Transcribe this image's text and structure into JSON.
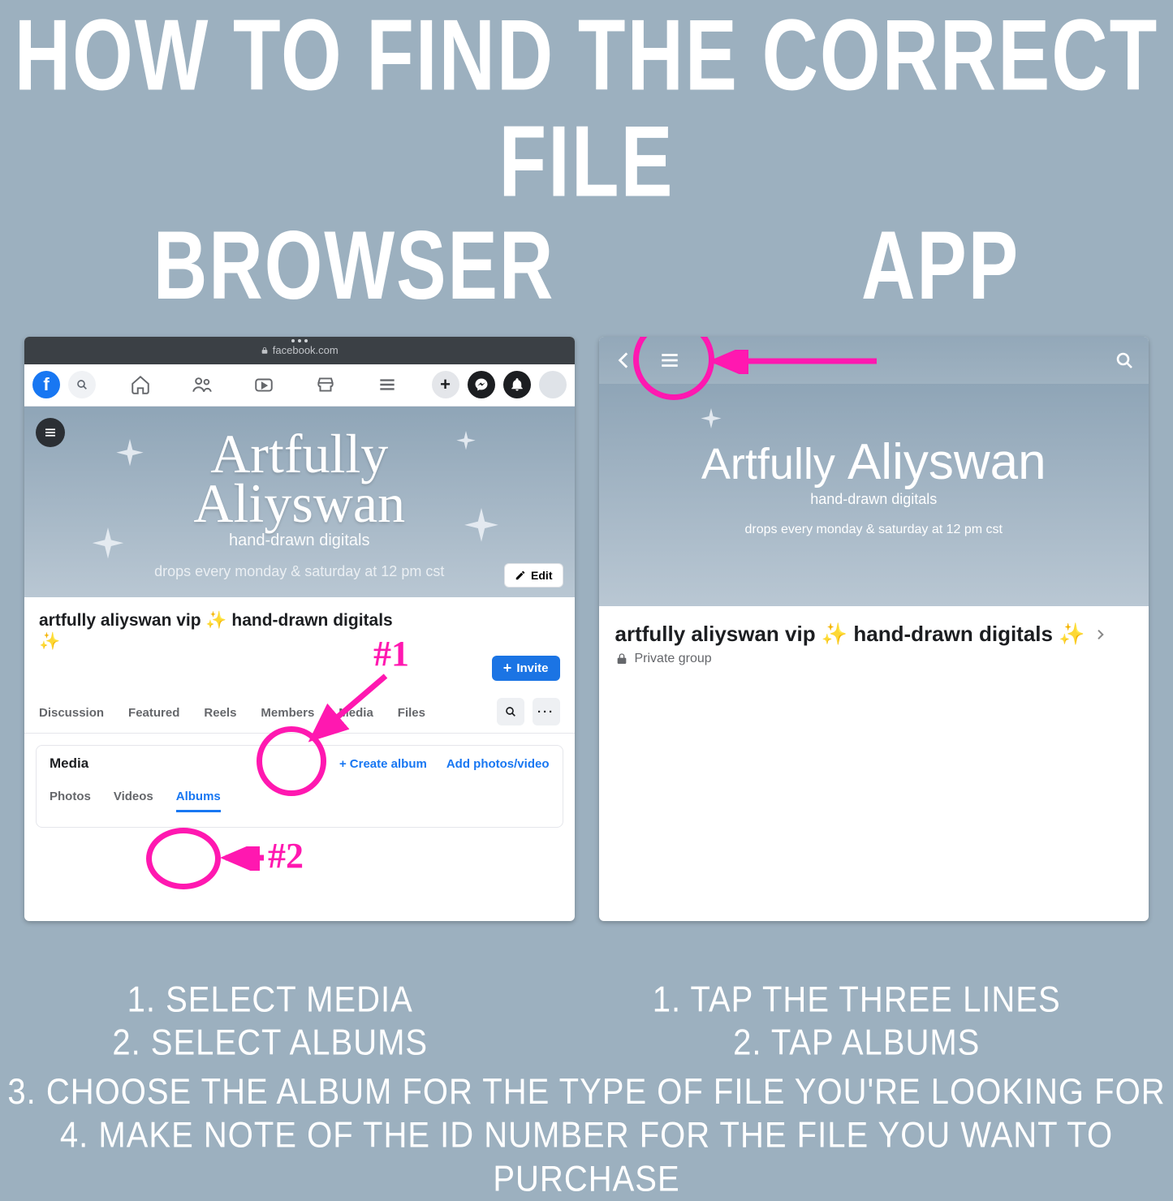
{
  "heading": "HOW TO FIND THE CORRECT FILE",
  "labels": {
    "browser": "BROWSER",
    "app": "APP"
  },
  "browser": {
    "address": "facebook.com",
    "group_title": "artfully aliyswan vip ✨ hand-drawn digitals ✨",
    "edit_label": "Edit",
    "invite_label": "Invite",
    "tabs": {
      "discussion": "Discussion",
      "featured": "Featured",
      "reels": "Reels",
      "members": "Members",
      "media": "Media",
      "files": "Files"
    },
    "media": {
      "section_title": "Media",
      "create_album": "Create album",
      "add_photos": "Add photos/video",
      "subtabs": {
        "photos": "Photos",
        "videos": "Videos",
        "albums": "Albums"
      }
    },
    "annotations": {
      "step1": "#1",
      "step2": "#2"
    },
    "cover": {
      "brand_line1": "Artfully",
      "brand_line2": "Aliyswan",
      "tagline": "hand-drawn digitals",
      "drops": "drops every monday & saturday at 12 pm cst"
    }
  },
  "app": {
    "group_title": "artfully aliyswan vip ✨ hand-drawn digitals ✨",
    "privacy": "Private group",
    "cover": {
      "brand_line1": "Artfully",
      "brand_line2": "Aliyswan",
      "tagline": "hand-drawn digitals",
      "drops": "drops every monday & saturday at 12 pm cst"
    }
  },
  "instructions": {
    "browser": {
      "s1": "1. SELECT MEDIA",
      "s2": "2. SELECT ALBUMS"
    },
    "app": {
      "s1": "1. TAP THE THREE LINES",
      "s2": "2. TAP ALBUMS"
    },
    "shared": {
      "s3": "3. CHOOSE THE ALBUM FOR THE TYPE OF FILE YOU'RE LOOKING FOR",
      "s4": "4. MAKE NOTE OF THE ID NUMBER FOR THE FILE YOU WANT TO PURCHASE"
    }
  }
}
